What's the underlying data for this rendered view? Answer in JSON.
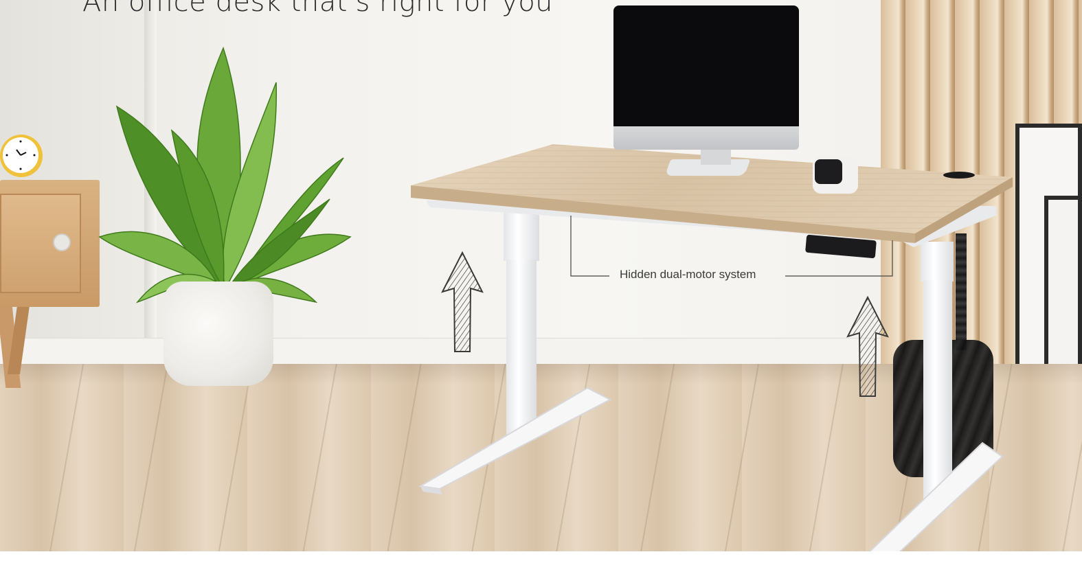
{
  "headline": "An office desk that's right for you",
  "callout": {
    "label": "Hidden dual-motor system"
  },
  "colors": {
    "desktop_wood": "#d9c3a6",
    "frame_white": "#f5f5f5",
    "floor_wood": "#dcc9b0",
    "arrow_stroke": "#3a3a3a",
    "text": "#2a2a2a"
  },
  "icons": {
    "arrow_left": "hatched-up-arrow-icon",
    "arrow_right": "hatched-up-arrow-icon"
  }
}
